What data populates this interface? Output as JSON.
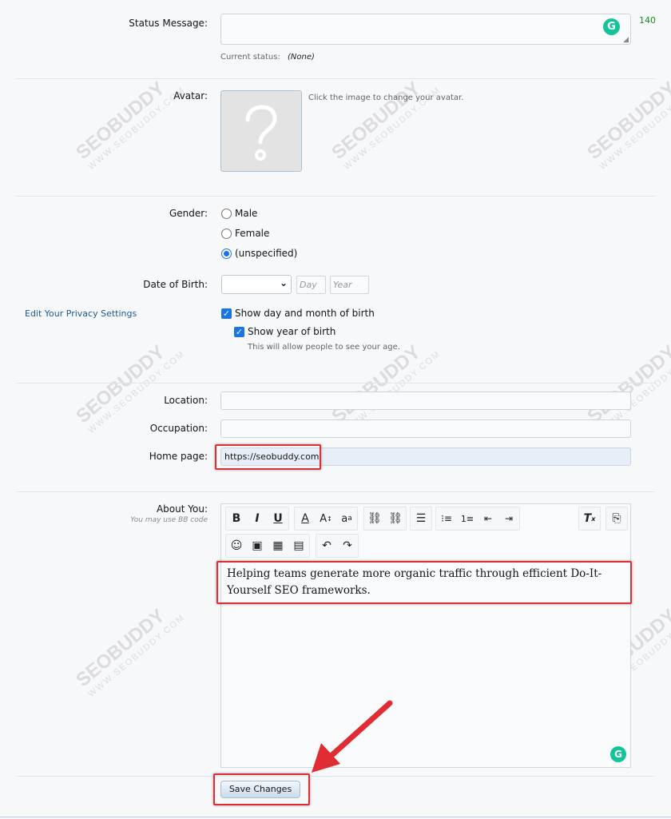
{
  "status": {
    "label": "Status Message:",
    "char_count": "140",
    "current_prefix": "Current status:",
    "current_value": "(None)"
  },
  "avatar": {
    "label": "Avatar:",
    "hint": "Click the image to change your avatar."
  },
  "gender": {
    "label": "Gender:",
    "options": [
      "Male",
      "Female",
      "(unspecified)"
    ],
    "selected": "(unspecified)"
  },
  "dob": {
    "label": "Date of Birth:",
    "month_value": "",
    "day_placeholder": "Day",
    "year_placeholder": "Year"
  },
  "privacy": {
    "link": "Edit Your Privacy Settings",
    "show_day_month": "Show day and month of birth",
    "show_year": "Show year of birth",
    "year_hint": "This will allow people to see your age."
  },
  "fields": {
    "location_label": "Location:",
    "occupation_label": "Occupation:",
    "homepage_label": "Home page:",
    "homepage_value": "https://seobuddy.com"
  },
  "about": {
    "label": "About You:",
    "bb_hint": "You may use BB code",
    "text": "Helping teams generate more organic traffic through efficient Do-It-Yourself SEO frameworks."
  },
  "save_label": "Save Changes",
  "watermark": {
    "brand": "SEOBUDDY",
    "url": "WWW.SEOBUDDY.COM"
  },
  "colors": {
    "link": "#1d5a8c",
    "accent_red": "#e02c33",
    "grammarly": "#15c39a",
    "count_green": "#1a8a1a"
  }
}
